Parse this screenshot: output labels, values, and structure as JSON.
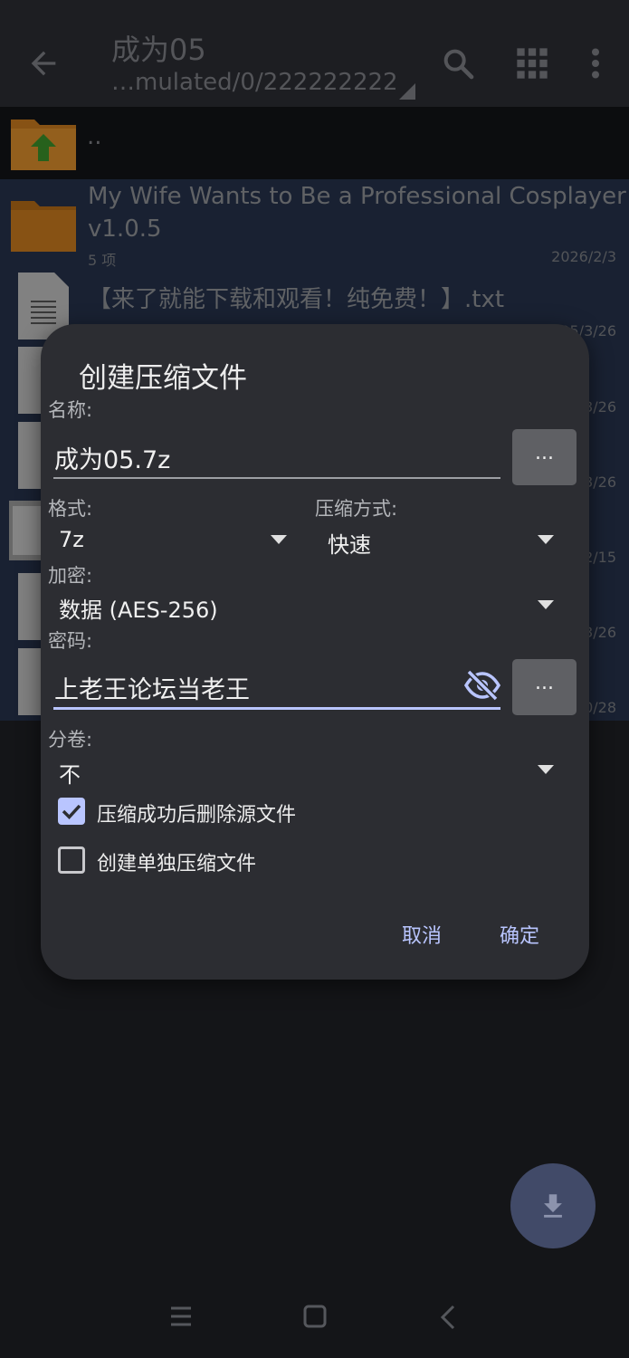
{
  "appbar": {
    "title": "成为05",
    "path": "…mulated/0/222222222"
  },
  "files": {
    "parent_label": "..",
    "items": [
      {
        "name_line1": "My Wife Wants to Be a Professional Cosplayer",
        "name_line2": "v1.0.5",
        "sub": "5 项",
        "date": "2026/2/3"
      },
      {
        "name": "【来了就能下载和观看！纯免费！】.txt",
        "date": "2025/3/26"
      },
      {
        "date": "3/26"
      },
      {
        "date": "3/26"
      },
      {
        "date": "2/15"
      },
      {
        "date": "3/26"
      },
      {
        "date": "0/28"
      }
    ]
  },
  "dialog": {
    "title": "创建压缩文件",
    "name_label": "名称:",
    "name_value": "成为05.7z",
    "browse_label": "...",
    "format_label": "格式:",
    "format_value": "7z",
    "method_label": "压缩方式:",
    "method_value": "快速",
    "encrypt_label": "加密:",
    "encrypt_value": "数据 (AES-256)",
    "password_label": "密码:",
    "password_value": "上老王论坛当老王",
    "password_btn_label": "...",
    "split_label": "分卷:",
    "split_value": "不",
    "delete_source_label": "压缩成功后删除源文件",
    "delete_source_checked": true,
    "separate_label": "创建单独压缩文件",
    "separate_checked": false,
    "cancel_label": "取消",
    "ok_label": "确定"
  },
  "colors": {
    "accent": "#b9c5ff",
    "dialog_bg": "#2c2d32",
    "selection_bg": "#26324a",
    "folder": "#c87a1e"
  }
}
